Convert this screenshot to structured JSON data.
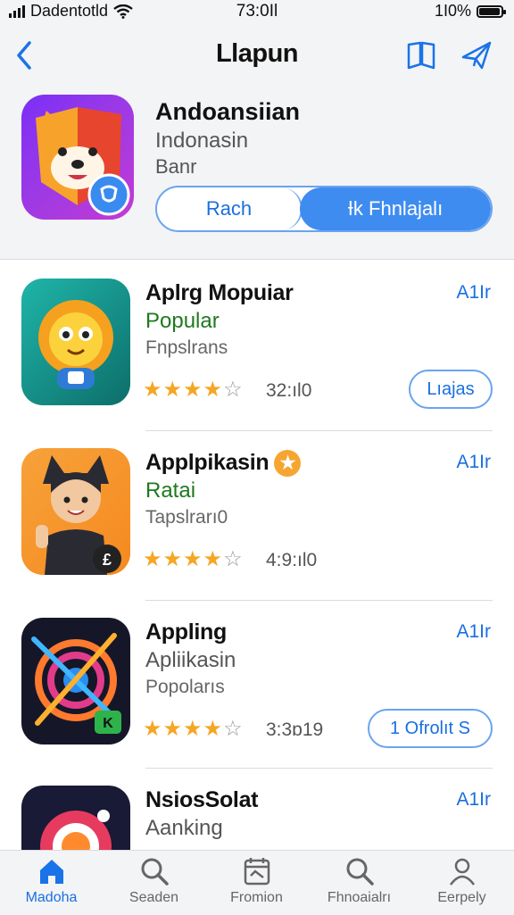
{
  "status_bar": {
    "carrier": "Dadentotld",
    "time": "73:0Il",
    "battery": "1I0%",
    "battery_level": 0.95
  },
  "nav": {
    "title": "Llapun"
  },
  "hero": {
    "name": "Andoansiian",
    "subtitle": "Indonasin",
    "tagline": "Banr",
    "segment_left": "Rach",
    "segment_right": "Ɨk Fhnlajalı"
  },
  "apps": [
    {
      "name": "Aplrg Mopuiar",
      "category": "Popular",
      "category_color": "#1f7a1f",
      "subtitle": "Fnpslrans",
      "rating": 3.5,
      "count": "32:ıl0",
      "price": "A1Ir",
      "button": "Lıajas"
    },
    {
      "name": "Applpikasin",
      "category": "Ratai",
      "category_color": "#1f7a1f",
      "subtitle": "Tapslrarı0",
      "rating": 3.5,
      "count": "4:9:ıl0",
      "price": "A1Ir",
      "button": ""
    },
    {
      "name": "Appling",
      "category": "Apliikasin",
      "category_color": "#555555",
      "subtitle": "Popolarıs",
      "rating": 3.5,
      "count": "3:3ɒ19",
      "price": "A1Ir",
      "button": "1 Ofrolıt S"
    },
    {
      "name": "NsiosSolat",
      "category": "Aanking",
      "category_color": "#555555",
      "subtitle": "",
      "rating": 0,
      "count": "",
      "price": "A1Ir",
      "button": ""
    }
  ],
  "tabs": [
    {
      "label": "Madoha",
      "icon": "house-icon",
      "active": true
    },
    {
      "label": "Seaden",
      "icon": "search-icon",
      "active": false
    },
    {
      "label": "Fromion",
      "icon": "calendar-icon",
      "active": false
    },
    {
      "label": "Fhnoaialrı",
      "icon": "search-icon",
      "active": false
    },
    {
      "label": "Eerpely",
      "icon": "person-icon",
      "active": false
    }
  ]
}
